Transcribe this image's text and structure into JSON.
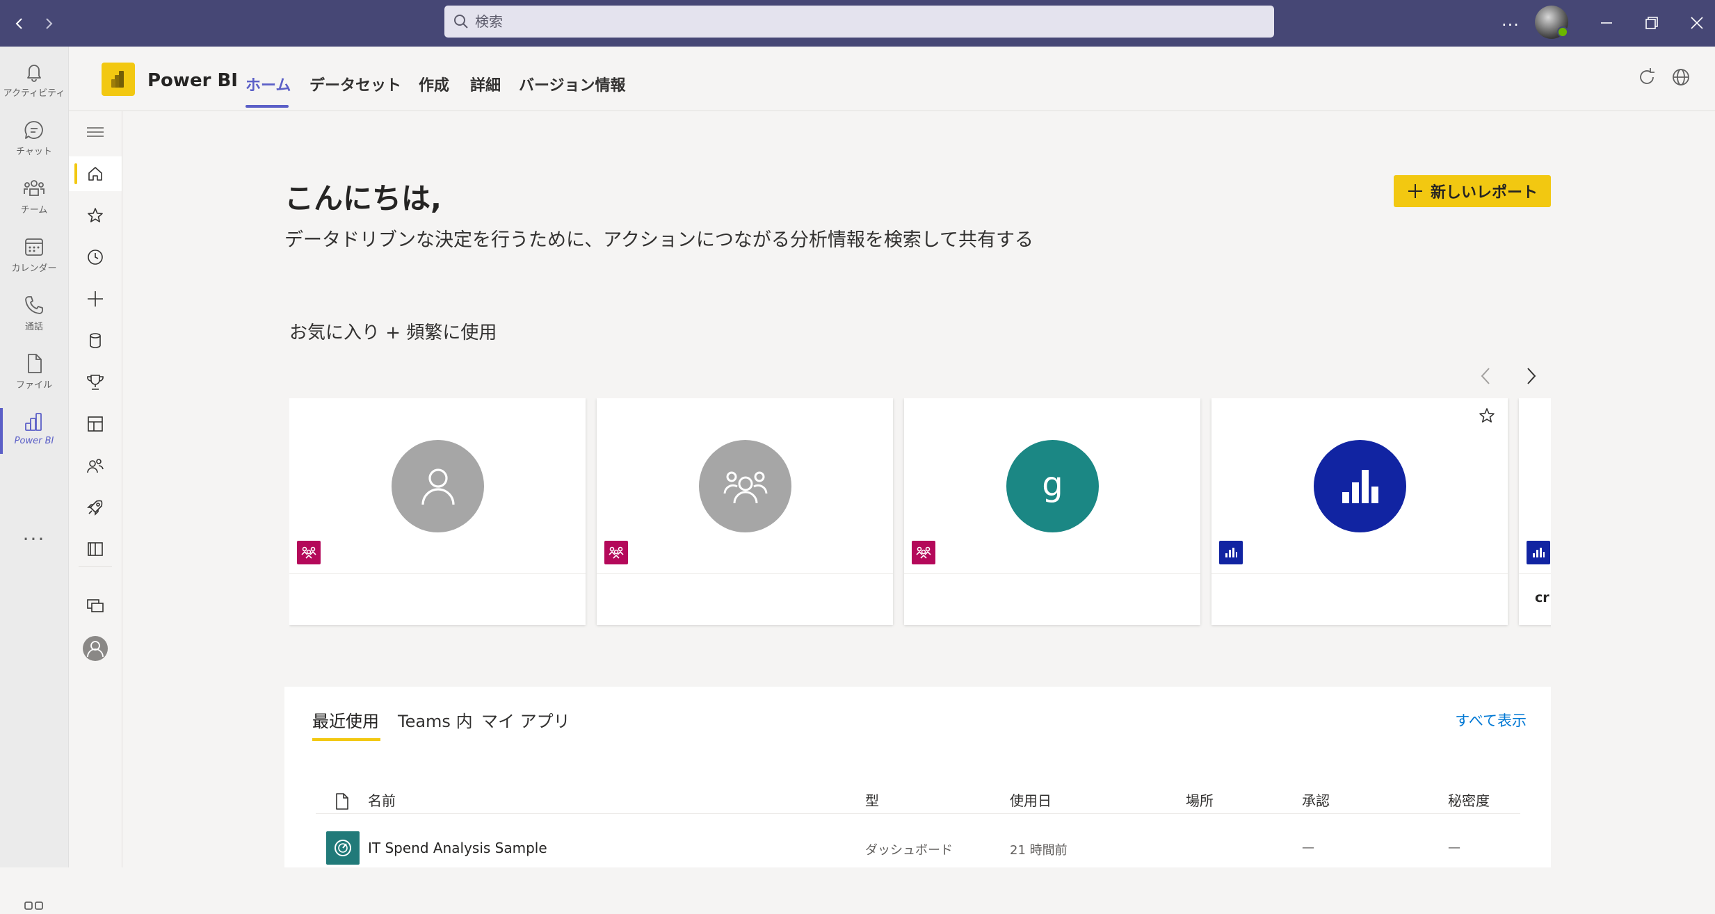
{
  "titlebar": {
    "search_placeholder": "検索",
    "more_label": "...",
    "color": "#464775"
  },
  "appbar": {
    "items": [
      {
        "label": "アクティビティ",
        "icon": "bell-icon"
      },
      {
        "label": "チャット",
        "icon": "chat-icon"
      },
      {
        "label": "チーム",
        "icon": "teams-icon"
      },
      {
        "label": "カレンダー",
        "icon": "calendar-icon"
      },
      {
        "label": "通話",
        "icon": "phone-icon"
      },
      {
        "label": "ファイル",
        "icon": "file-icon"
      },
      {
        "label": "Power BI",
        "icon": "power-bi-icon",
        "active": true
      }
    ],
    "more_label": "...",
    "active_color": "#5b5fc7"
  },
  "header": {
    "app_name": "Power BI",
    "tabs": [
      {
        "label": "ホーム",
        "active": true
      },
      {
        "label": "データセット"
      },
      {
        "label": "作成"
      },
      {
        "label": "詳細"
      },
      {
        "label": "バージョン情報"
      }
    ],
    "accent_color": "#f2c811"
  },
  "nav": {
    "items": [
      "hamburger-icon",
      "home-icon",
      "star-icon",
      "clock-icon",
      "plus-icon",
      "database-icon",
      "trophy-icon",
      "workspace-icon",
      "people-icon",
      "rocket-icon",
      "book-icon",
      "monitor-icon",
      "account-icon"
    ]
  },
  "main": {
    "greeting": "こんにちは,",
    "subtitle": "データドリブンな決定を行うために、アクションにつながる分析情報を検索して共有する",
    "new_report_label": "新しいレポート",
    "favorites_title": "お気に入り + 頻繁に使用",
    "cards": [
      {
        "thumb": "person-icon",
        "thumb_color": "#a6a6a6",
        "type": "workspace",
        "badge_color": "#b4095a",
        "name": ""
      },
      {
        "thumb": "group-icon",
        "thumb_color": "#a6a6a6",
        "type": "workspace",
        "badge_color": "#b4095a",
        "name": ""
      },
      {
        "thumb_letter": "g",
        "thumb_color": "#1b8784",
        "type": "workspace",
        "badge_color": "#b4095a",
        "name": ""
      },
      {
        "thumb": "bar-chart-icon",
        "thumb_color": "#1124a2",
        "type": "report",
        "badge_color": "#1124a2",
        "name": "",
        "favorite": true
      },
      {
        "thumb": "bar-chart-icon",
        "thumb_color": "#1124a2",
        "type": "report",
        "badge_color": "#1124a2",
        "name": "cr"
      }
    ]
  },
  "recent": {
    "tabs": [
      {
        "label": "最近使用",
        "active": true
      },
      {
        "label": "Teams 内"
      },
      {
        "label": "マイ アプリ"
      }
    ],
    "see_all": "すべて表示",
    "columns": [
      "名前",
      "型",
      "使用日",
      "場所",
      "承認",
      "秘密度"
    ],
    "rows": [
      {
        "icon": "dashboard-icon",
        "name": "IT Spend Analysis Sample",
        "type": "ダッシュボード",
        "used": "21 時間前",
        "location": "",
        "endorsement": "—",
        "sensitivity": "—"
      }
    ]
  }
}
